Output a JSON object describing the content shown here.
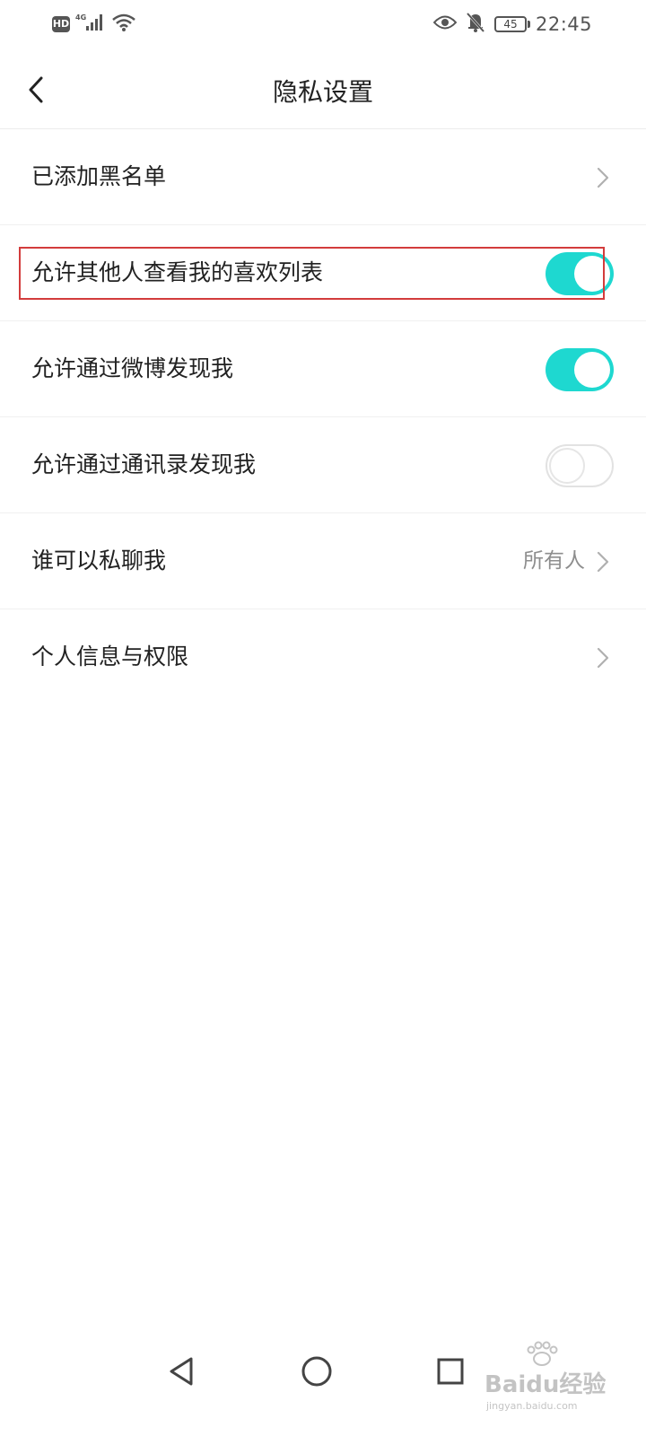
{
  "status_bar": {
    "hd": "HD",
    "network": "4G",
    "battery": "45",
    "time": "22:45",
    "icons": [
      "hd-icon",
      "signal-icon",
      "wifi-icon",
      "eye-icon",
      "mute-bell-icon",
      "battery-icon"
    ]
  },
  "header": {
    "title": "隐私设置",
    "back_icon": "back-arrow-icon"
  },
  "settings": [
    {
      "label": "已添加黑名单",
      "type": "link"
    },
    {
      "label": "允许其他人查看我的喜欢列表",
      "type": "toggle",
      "on": true
    },
    {
      "label": "允许通过微博发现我",
      "type": "toggle",
      "on": true
    },
    {
      "label": "允许通过通讯录发现我",
      "type": "toggle",
      "on": false
    },
    {
      "label": "谁可以私聊我",
      "type": "link",
      "value": "所有人"
    },
    {
      "label": "个人信息与权限",
      "type": "link"
    }
  ],
  "nav_bar": {
    "icons": [
      "back-triangle-icon",
      "home-circle-icon",
      "recents-square-icon"
    ]
  },
  "watermark": {
    "brand": "Baidu经验",
    "url": "jingyan.baidu.com"
  },
  "colors": {
    "toggle_on": "#1ed8d0",
    "highlight": "#d33c3c",
    "text": "#222222",
    "secondary": "#8e8e8e"
  }
}
